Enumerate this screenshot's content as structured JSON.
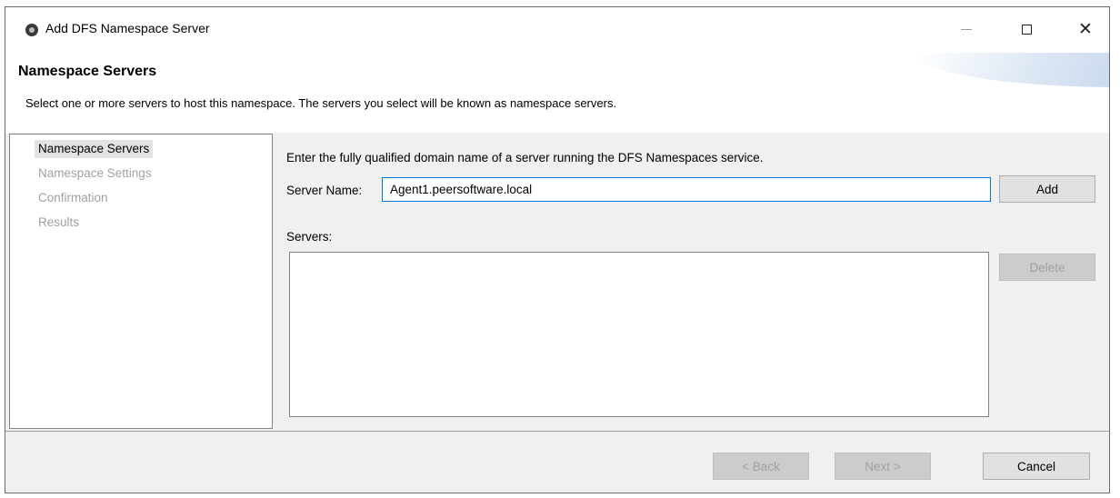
{
  "window": {
    "title": "Add DFS Namespace Server",
    "icon": "app-logo-icon"
  },
  "header": {
    "title": "Namespace Servers",
    "description": "Select one or more servers to host this namespace. The servers you select will be known as namespace servers."
  },
  "nav": {
    "items": [
      {
        "label": "Namespace Servers",
        "state": "active"
      },
      {
        "label": "Namespace Settings",
        "state": "disabled"
      },
      {
        "label": "Confirmation",
        "state": "disabled"
      },
      {
        "label": "Results",
        "state": "disabled"
      }
    ]
  },
  "content": {
    "instruction": "Enter the fully qualified domain name of a server running the DFS Namespaces service.",
    "server_name_label": "Server Name:",
    "server_name_value": "Agent1.peersoftware.local",
    "add_label": "Add",
    "servers_label": "Servers:",
    "delete_label": "Delete"
  },
  "footer": {
    "back_label": "< Back",
    "next_label": "Next >",
    "cancel_label": "Cancel"
  },
  "colors": {
    "focus_border": "#0078d7",
    "disabled_text": "#a0a0a0",
    "selected_bg": "#e3e3e3"
  }
}
